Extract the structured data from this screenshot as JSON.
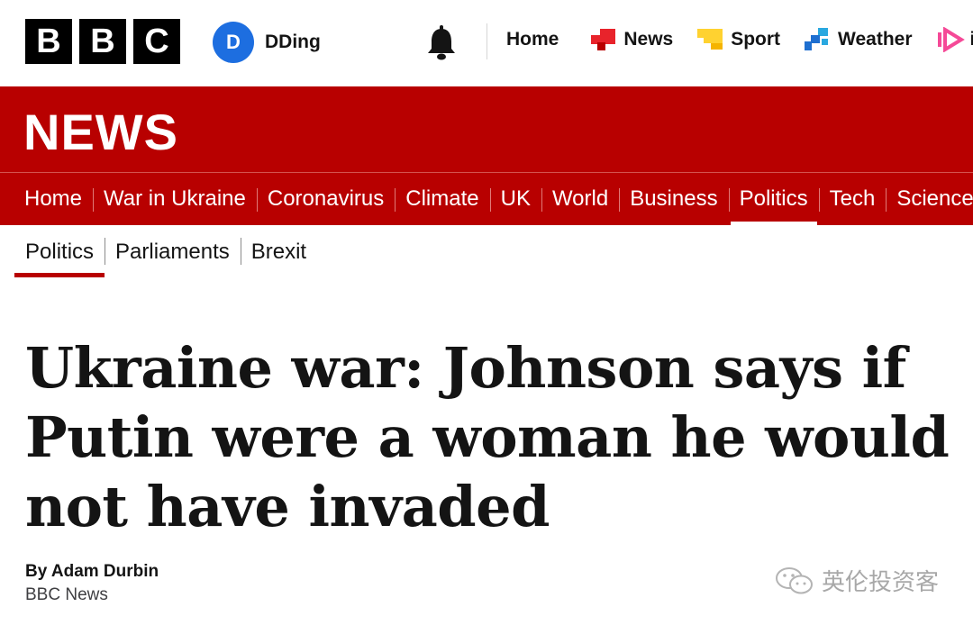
{
  "brand": {
    "letters": [
      "B",
      "B",
      "C"
    ]
  },
  "account": {
    "initial": "D",
    "name": "DDing"
  },
  "top_nav": {
    "home": "Home",
    "news": "News",
    "sport": "Sport",
    "weather": "Weather",
    "iplayer": "iP",
    "icons": [
      "bell-icon",
      "news-icon",
      "sport-icon",
      "weather-icon",
      "iplayer-icon"
    ]
  },
  "banner": {
    "title": "NEWS",
    "color": "#b80000"
  },
  "section_nav": {
    "items": [
      "Home",
      "War in Ukraine",
      "Coronavirus",
      "Climate",
      "UK",
      "World",
      "Business",
      "Politics",
      "Tech",
      "Science"
    ],
    "active": "Politics"
  },
  "sub_nav": {
    "items": [
      "Politics",
      "Parliaments",
      "Brexit"
    ],
    "active": "Politics"
  },
  "article": {
    "headline_lines": [
      "Ukraine war: Johnson says if",
      "Putin were a woman he would",
      "not have invaded"
    ],
    "byline_author": "By Adam Durbin",
    "byline_source": "BBC News"
  },
  "watermark": {
    "text": "英伦投资客"
  }
}
